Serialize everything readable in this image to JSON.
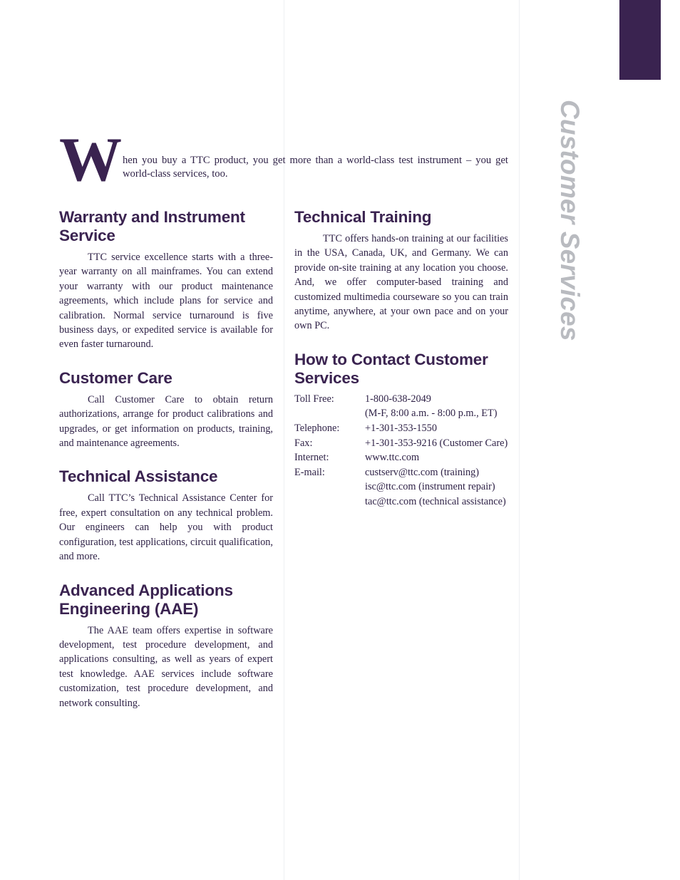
{
  "side_title": "Customer Services",
  "colors": {
    "heading": "#3a2350",
    "body": "#2f2247",
    "tab": "#3a2350",
    "side_title": "#b9bbc0",
    "rule": "#eef0f2"
  },
  "intro": {
    "dropcap": "W",
    "text": "hen you buy a TTC product, you get more than a world-class test instrument – you get world-class services, too."
  },
  "left_column": [
    {
      "heading": "Warranty and Instrument Service",
      "body": "TTC service excellence starts with a three-year warranty on all mainframes. You can extend your warranty with our product maintenance agreements, which include plans for service and calibration. Normal service turnaround is five business days, or expedited service is available for even faster turnaround."
    },
    {
      "heading": "Customer Care",
      "body": "Call Customer Care to obtain return authorizations, arrange for product calibrations and upgrades, or get information on products, training, and maintenance agreements."
    },
    {
      "heading": "Technical Assistance",
      "body": "Call TTC’s Technical Assistance Center for free, expert consultation on any technical problem. Our engineers can help you with product configuration, test applications, circuit qualification, and more."
    },
    {
      "heading": "Advanced Applications Engineering (AAE)",
      "body": "The AAE team offers expertise in software development, test procedure development, and applications consulting, as well as years of expert test knowledge. AAE services include software customization, test procedure development, and network consulting."
    }
  ],
  "right_column": {
    "training": {
      "heading": "Technical Training",
      "body": "TTC offers hands-on training at our facilities in the USA, Canada, UK, and Germany. We can provide on-site training at any location you choose. And, we offer computer-based training and customized multimedia courseware so you can train anytime, anywhere, at your own pace and on your own PC."
    },
    "contact": {
      "heading": "How to Contact Customer Services",
      "rows": [
        {
          "label": "Toll Free:",
          "value": "1-800-638-2049"
        },
        {
          "label": "",
          "value": "(M-F, 8:00 a.m. - 8:00 p.m., ET)"
        },
        {
          "label": "Telephone:",
          "value": "+1-301-353-1550"
        },
        {
          "label": "Fax:",
          "value": "+1-301-353-9216 (Customer Care)"
        },
        {
          "label": "Internet:",
          "value": "www.ttc.com"
        },
        {
          "label": "E-mail:",
          "value": "custserv@ttc.com  (training)"
        },
        {
          "label": "",
          "value": "isc@ttc.com (instrument repair)"
        },
        {
          "label": "",
          "value": "tac@ttc.com (technical assistance)"
        }
      ]
    }
  }
}
